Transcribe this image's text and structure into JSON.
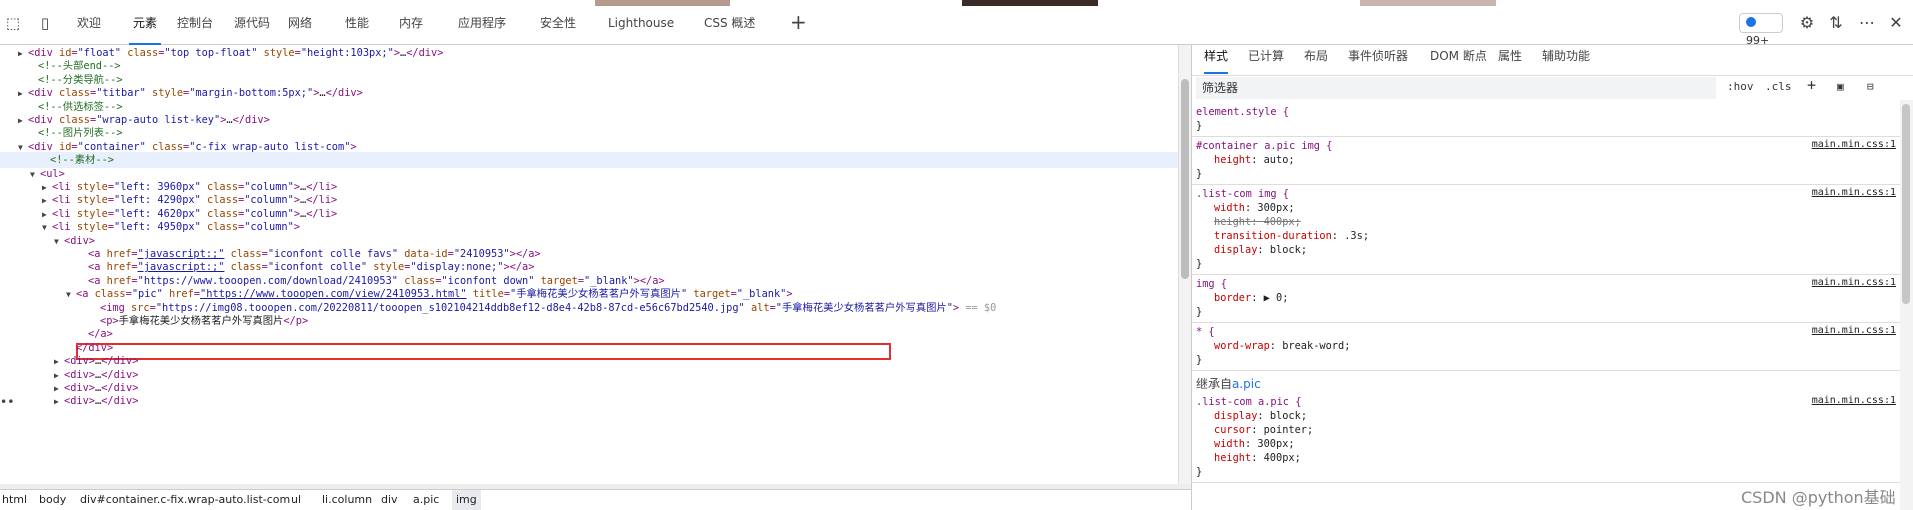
{
  "toolbar": {
    "tabs": [
      "欢迎",
      "元素",
      "控制台",
      "源代码",
      "网络",
      "性能",
      "内存",
      "应用程序",
      "安全性",
      "Lighthouse",
      "CSS 概述"
    ],
    "active_tab": "元素",
    "add_tab_icon": "plus-icon",
    "badge_count": "99+",
    "colors": {
      "accent": "#1a73e8",
      "badge_dot": "#1a73e8"
    }
  },
  "dom": {
    "lines": [
      {
        "t": "line",
        "tri": "▶",
        "ind": 28,
        "parts": [
          [
            "tag",
            "<div "
          ],
          [
            "attr",
            "id"
          ],
          [
            "tag",
            "="
          ],
          [
            "val",
            "\"float\""
          ],
          [
            "tag",
            " "
          ],
          [
            "attr",
            "class"
          ],
          [
            "tag",
            "="
          ],
          [
            "val",
            "\"top top-float\""
          ],
          [
            "tag",
            " "
          ],
          [
            "attr",
            "style"
          ],
          [
            "tag",
            "="
          ],
          [
            "val",
            "\"height:103px;\""
          ],
          [
            "tag",
            ">"
          ],
          [
            "txt",
            "…"
          ],
          [
            "tag",
            "</div>"
          ]
        ]
      },
      {
        "t": "line",
        "ind": 38,
        "parts": [
          [
            "cmt",
            "<!--头部end-->"
          ]
        ]
      },
      {
        "t": "line",
        "ind": 38,
        "parts": [
          [
            "cmt",
            "<!--分类导航-->"
          ]
        ]
      },
      {
        "t": "line",
        "tri": "▶",
        "ind": 28,
        "parts": [
          [
            "tag",
            "<div "
          ],
          [
            "attr",
            "class"
          ],
          [
            "tag",
            "="
          ],
          [
            "val",
            "\"titbar\""
          ],
          [
            "tag",
            " "
          ],
          [
            "attr",
            "style"
          ],
          [
            "tag",
            "="
          ],
          [
            "val",
            "\"margin-bottom:5px;\""
          ],
          [
            "tag",
            ">"
          ],
          [
            "txt",
            "…"
          ],
          [
            "tag",
            "</div>"
          ]
        ]
      },
      {
        "t": "line",
        "ind": 38,
        "parts": [
          [
            "cmt",
            "<!--供选标签-->"
          ]
        ]
      },
      {
        "t": "line",
        "tri": "▶",
        "ind": 28,
        "parts": [
          [
            "tag",
            "<div "
          ],
          [
            "attr",
            "class"
          ],
          [
            "tag",
            "="
          ],
          [
            "val",
            "\"wrap-auto list-key\""
          ],
          [
            "tag",
            ">"
          ],
          [
            "txt",
            "…"
          ],
          [
            "tag",
            "</div>"
          ]
        ]
      },
      {
        "t": "line",
        "ind": 38,
        "parts": [
          [
            "cmt",
            "<!--图片列表-->"
          ]
        ]
      },
      {
        "t": "line",
        "tri": "▼",
        "ind": 28,
        "parts": [
          [
            "tag",
            "<div "
          ],
          [
            "attr",
            "id"
          ],
          [
            "tag",
            "="
          ],
          [
            "val",
            "\"container\""
          ],
          [
            "tag",
            " "
          ],
          [
            "attr",
            "class"
          ],
          [
            "tag",
            "="
          ],
          [
            "val",
            "\"c-fix wrap-auto list-com\""
          ],
          [
            "tag",
            ">"
          ]
        ]
      },
      {
        "t": "line",
        "ind": 50,
        "parts": [
          [
            "cmt",
            "<!--素材-->"
          ]
        ],
        "hl": true
      },
      {
        "t": "line",
        "tri": "▼",
        "ind": 40,
        "parts": [
          [
            "tag",
            "<ul>"
          ]
        ]
      },
      {
        "t": "line",
        "tri": "▶",
        "ind": 52,
        "parts": [
          [
            "tag",
            "<li "
          ],
          [
            "attr",
            "style"
          ],
          [
            "tag",
            "="
          ],
          [
            "val",
            "\"left: 3960px\""
          ],
          [
            "tag",
            " "
          ],
          [
            "attr",
            "class"
          ],
          [
            "tag",
            "="
          ],
          [
            "val",
            "\"column\""
          ],
          [
            "tag",
            ">"
          ],
          [
            "txt",
            "…"
          ],
          [
            "tag",
            "</li>"
          ]
        ]
      },
      {
        "t": "line",
        "tri": "▶",
        "ind": 52,
        "parts": [
          [
            "tag",
            "<li "
          ],
          [
            "attr",
            "style"
          ],
          [
            "tag",
            "="
          ],
          [
            "val",
            "\"left: 4290px\""
          ],
          [
            "tag",
            " "
          ],
          [
            "attr",
            "class"
          ],
          [
            "tag",
            "="
          ],
          [
            "val",
            "\"column\""
          ],
          [
            "tag",
            ">"
          ],
          [
            "txt",
            "…"
          ],
          [
            "tag",
            "</li>"
          ]
        ]
      },
      {
        "t": "line",
        "tri": "▶",
        "ind": 52,
        "parts": [
          [
            "tag",
            "<li "
          ],
          [
            "attr",
            "style"
          ],
          [
            "tag",
            "="
          ],
          [
            "val",
            "\"left: 4620px\""
          ],
          [
            "tag",
            " "
          ],
          [
            "attr",
            "class"
          ],
          [
            "tag",
            "="
          ],
          [
            "val",
            "\"column\""
          ],
          [
            "tag",
            ">"
          ],
          [
            "txt",
            "…"
          ],
          [
            "tag",
            "</li>"
          ]
        ]
      },
      {
        "t": "line",
        "tri": "▼",
        "ind": 52,
        "parts": [
          [
            "tag",
            "<li "
          ],
          [
            "attr",
            "style"
          ],
          [
            "tag",
            "="
          ],
          [
            "val",
            "\"left: 4950px\""
          ],
          [
            "tag",
            " "
          ],
          [
            "attr",
            "class"
          ],
          [
            "tag",
            "="
          ],
          [
            "val",
            "\"column\""
          ],
          [
            "tag",
            ">"
          ]
        ]
      },
      {
        "t": "line",
        "tri": "▼",
        "ind": 64,
        "parts": [
          [
            "tag",
            "<div>"
          ]
        ]
      },
      {
        "t": "line",
        "ind": 88,
        "parts": [
          [
            "tag",
            "<a "
          ],
          [
            "attr",
            "href"
          ],
          [
            "tag",
            "="
          ],
          [
            "link",
            "\"javascript:;\""
          ],
          [
            "tag",
            " "
          ],
          [
            "attr",
            "class"
          ],
          [
            "tag",
            "="
          ],
          [
            "val",
            "\"iconfont colle favs\""
          ],
          [
            "tag",
            " "
          ],
          [
            "attr",
            "data-id"
          ],
          [
            "tag",
            "="
          ],
          [
            "val",
            "\"2410953\""
          ],
          [
            "tag",
            ">"
          ],
          [
            "txt",
            ""
          ],
          [
            "tag",
            "</a>"
          ]
        ]
      },
      {
        "t": "line",
        "ind": 88,
        "parts": [
          [
            "tag",
            "<a "
          ],
          [
            "attr",
            "href"
          ],
          [
            "tag",
            "="
          ],
          [
            "link",
            "\"javascript:;\""
          ],
          [
            "tag",
            " "
          ],
          [
            "attr",
            "class"
          ],
          [
            "tag",
            "="
          ],
          [
            "val",
            "\"iconfont colle\""
          ],
          [
            "tag",
            " "
          ],
          [
            "attr",
            "style"
          ],
          [
            "tag",
            "="
          ],
          [
            "val",
            "\"display:none;\""
          ],
          [
            "tag",
            ">"
          ],
          [
            "txt",
            ""
          ],
          [
            "tag",
            "</a>"
          ]
        ]
      },
      {
        "t": "line",
        "ind": 88,
        "parts": [
          [
            "tag",
            "<a "
          ],
          [
            "attr",
            "href"
          ],
          [
            "tag",
            "="
          ],
          [
            "val",
            "\"https://www.tooopen.com/download/2410953\""
          ],
          [
            "tag",
            " "
          ],
          [
            "attr",
            "class"
          ],
          [
            "tag",
            "="
          ],
          [
            "val",
            "\"iconfont down\""
          ],
          [
            "tag",
            " "
          ],
          [
            "attr",
            "target"
          ],
          [
            "tag",
            "="
          ],
          [
            "val",
            "\"_blank\""
          ],
          [
            "tag",
            ">"
          ],
          [
            "txt",
            ""
          ],
          [
            "tag",
            "</a>"
          ]
        ]
      },
      {
        "t": "line",
        "tri": "▼",
        "ind": 76,
        "parts": [
          [
            "tag",
            "<a "
          ],
          [
            "attr",
            "class"
          ],
          [
            "tag",
            "="
          ],
          [
            "val",
            "\"pic\""
          ],
          [
            "tag",
            " "
          ],
          [
            "attr",
            "href"
          ],
          [
            "tag",
            "="
          ],
          [
            "link",
            "\"https://www.tooopen.com/view/2410953.html\""
          ],
          [
            "tag",
            " "
          ],
          [
            "attr",
            "title"
          ],
          [
            "tag",
            "="
          ],
          [
            "val",
            "\"手拿梅花美少女杨茗茗户外写真图片\""
          ],
          [
            "tag",
            " "
          ],
          [
            "attr",
            "target"
          ],
          [
            "tag",
            "="
          ],
          [
            "val",
            "\"_blank\""
          ],
          [
            "tag",
            ">"
          ]
        ]
      },
      {
        "t": "line",
        "ind": 100,
        "parts": [
          [
            "tag",
            "<img "
          ],
          [
            "attr",
            "src"
          ],
          [
            "tag",
            "="
          ],
          [
            "val",
            "\"https://img08.tooopen.com/20220811/tooopen_s102104214ddb8ef12-d8e4-42b8-87cd-e56c67bd2540.jpg\""
          ],
          [
            "tag",
            " "
          ],
          [
            "attr",
            "alt"
          ],
          [
            "tag",
            "="
          ],
          [
            "val",
            "\"手拿梅花美少女杨茗茗户外写真图片\""
          ],
          [
            "tag",
            ">"
          ],
          [
            "dim",
            " == $0"
          ]
        ],
        "sel": true
      },
      {
        "t": "line",
        "ind": 100,
        "parts": [
          [
            "tag",
            "<p>"
          ],
          [
            "txt",
            "手拿梅花美少女杨茗茗户外写真图片"
          ],
          [
            "tag",
            "</p>"
          ]
        ]
      },
      {
        "t": "line",
        "ind": 88,
        "parts": [
          [
            "tag",
            "</a>"
          ]
        ]
      },
      {
        "t": "line",
        "ind": 76,
        "parts": [
          [
            "tag",
            "</div>"
          ]
        ]
      },
      {
        "t": "line",
        "tri": "▶",
        "ind": 64,
        "parts": [
          [
            "tag",
            "<div>"
          ],
          [
            "txt",
            "…"
          ],
          [
            "tag",
            "</div>"
          ]
        ]
      },
      {
        "t": "line",
        "tri": "▶",
        "ind": 64,
        "parts": [
          [
            "tag",
            "<div>"
          ],
          [
            "txt",
            "…"
          ],
          [
            "tag",
            "</div>"
          ]
        ]
      },
      {
        "t": "line",
        "tri": "▶",
        "ind": 64,
        "parts": [
          [
            "tag",
            "<div>"
          ],
          [
            "txt",
            "…"
          ],
          [
            "tag",
            "</div>"
          ]
        ]
      },
      {
        "t": "line",
        "tri": "▶",
        "ind": 64,
        "parts": [
          [
            "tag",
            "<div>"
          ],
          [
            "txt",
            "…"
          ],
          [
            "tag",
            "</div>"
          ]
        ]
      }
    ],
    "side_dots": "••"
  },
  "breadcrumb": [
    "html",
    "body",
    "div#container.c-fix.wrap-auto.list-com",
    "ul",
    "li.column",
    "div",
    "a.pic",
    "img"
  ],
  "styles": {
    "tabs": [
      "样式",
      "已计算",
      "布局",
      "事件侦听器",
      "DOM 断点",
      "属性",
      "辅助功能"
    ],
    "active_tab": "样式",
    "filter_placeholder": "筛选器",
    "hov": ":hov",
    "cls": ".cls",
    "rules": [
      {
        "selector": "element.style {",
        "source": "",
        "lines": [
          "}"
        ]
      },
      {
        "selector": "#container a.pic img {",
        "source": "main.min.css:1",
        "lines": [
          [
            "height",
            "auto"
          ]
        ]
      },
      {
        "selector": ".list-com img {",
        "source": "main.min.css:1",
        "lines": [
          [
            "width",
            "300px"
          ],
          [
            "height",
            "400px",
            "strike"
          ],
          [
            "transition-duration",
            ".3s"
          ],
          [
            "display",
            "block"
          ]
        ]
      },
      {
        "selector": "img {",
        "source": "main.min.css:1",
        "lines": [
          [
            "border",
            "▶ 0"
          ]
        ]
      },
      {
        "selector": "* {",
        "source": "main.min.css:1",
        "lines": [
          [
            "word-wrap",
            "break-word"
          ]
        ]
      }
    ],
    "inherited_label": "继承自",
    "inherited_from": "a.pic",
    "inherited_rule": {
      "selector": ".list-com a.pic {",
      "source": "main.min.css:1",
      "lines": [
        [
          "display",
          "block"
        ],
        [
          "cursor",
          "pointer"
        ],
        [
          "width",
          "300px"
        ],
        [
          "height",
          "400px"
        ]
      ]
    }
  },
  "watermark": "CSDN @python基础"
}
